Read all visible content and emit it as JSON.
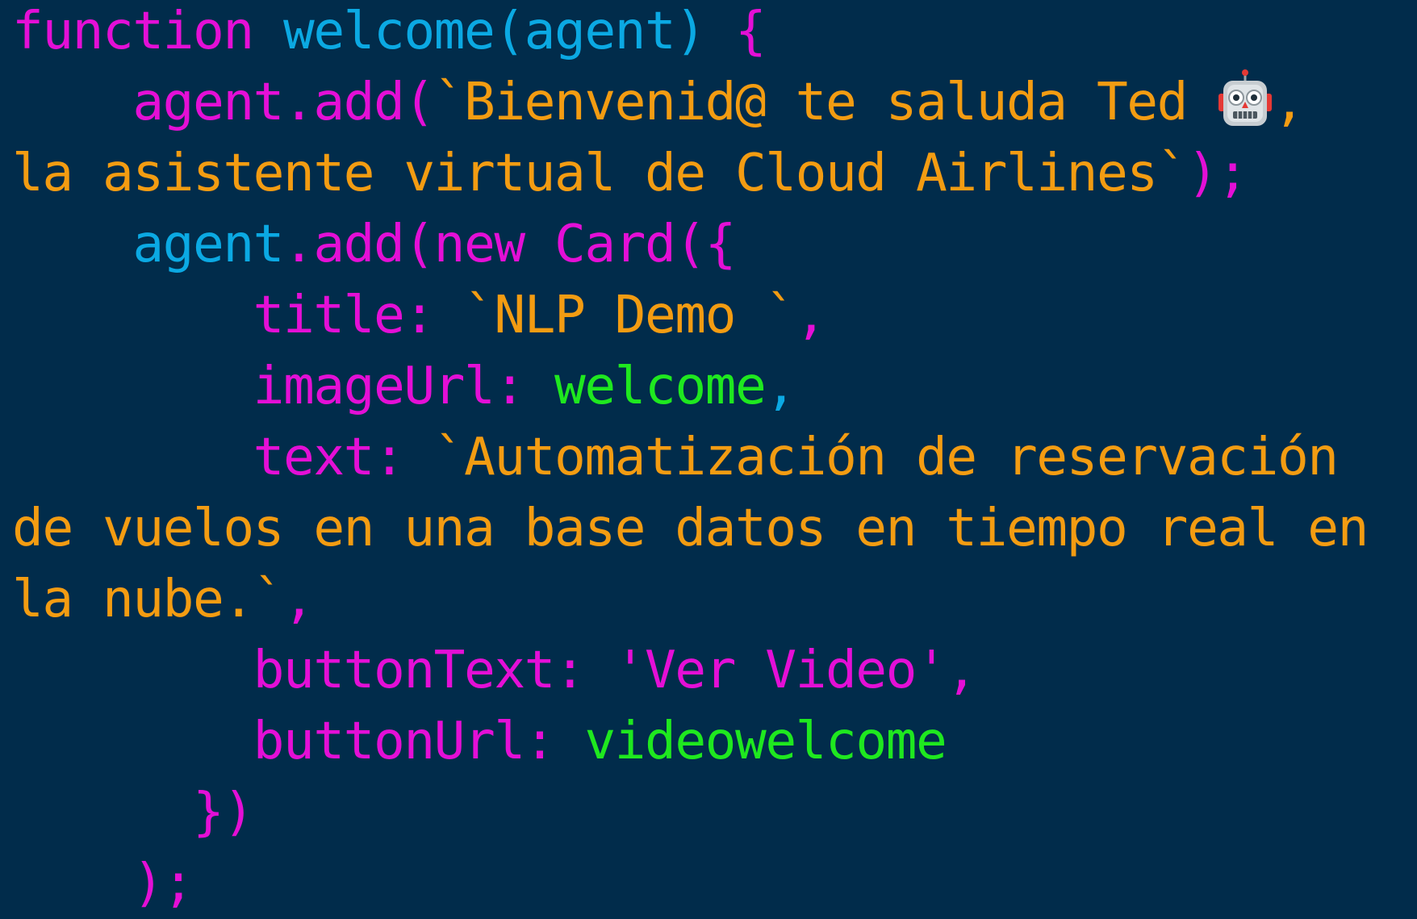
{
  "colors": {
    "background": "#012c4b",
    "keyword": "#e40fd6",
    "identifier": "#0ba9e3",
    "string": "#f39c12",
    "value": "#1fe81f"
  },
  "emoji_icon": "robot-face-icon",
  "code_lines": [
    [
      {
        "t": "function",
        "c": "keyword"
      },
      {
        "t": " ",
        "c": "keyword"
      },
      {
        "t": "welcome(agent)",
        "c": "identifier"
      },
      {
        "t": " {",
        "c": "keyword"
      }
    ],
    [
      {
        "t": "    agent.add(",
        "c": "keyword"
      },
      {
        "t": "`Bienvenid@ te saluda Ted ",
        "c": "string"
      },
      {
        "emoji": "robot-face-icon"
      },
      {
        "t": ",",
        "c": "string"
      }
    ],
    [
      {
        "t": "la asistente virtual de Cloud Airlines`",
        "c": "string"
      },
      {
        "t": ");",
        "c": "keyword"
      }
    ],
    [
      {
        "t": "    agent",
        "c": "identifier"
      },
      {
        "t": ".add(new Card({",
        "c": "keyword"
      }
    ],
    [
      {
        "t": "        title: ",
        "c": "keyword"
      },
      {
        "t": "`NLP Demo `",
        "c": "string"
      },
      {
        "t": ",",
        "c": "keyword"
      }
    ],
    [
      {
        "t": "        imageUrl: ",
        "c": "keyword"
      },
      {
        "t": "welcome",
        "c": "value"
      },
      {
        "t": ",",
        "c": "identifier"
      }
    ],
    [
      {
        "t": "        text: ",
        "c": "keyword"
      },
      {
        "t": "`Automatización de reservación",
        "c": "string"
      }
    ],
    [
      {
        "t": "de vuelos en una base datos en tiempo real en",
        "c": "string"
      }
    ],
    [
      {
        "t": "la nube.`",
        "c": "string"
      },
      {
        "t": ",",
        "c": "keyword"
      }
    ],
    [
      {
        "t": "        buttonText: 'Ver Video',",
        "c": "keyword"
      }
    ],
    [
      {
        "t": "        buttonUrl: ",
        "c": "keyword"
      },
      {
        "t": "videowelcome",
        "c": "value"
      }
    ],
    [
      {
        "t": "      })",
        "c": "keyword"
      }
    ],
    [
      {
        "t": "    );",
        "c": "keyword"
      }
    ]
  ]
}
